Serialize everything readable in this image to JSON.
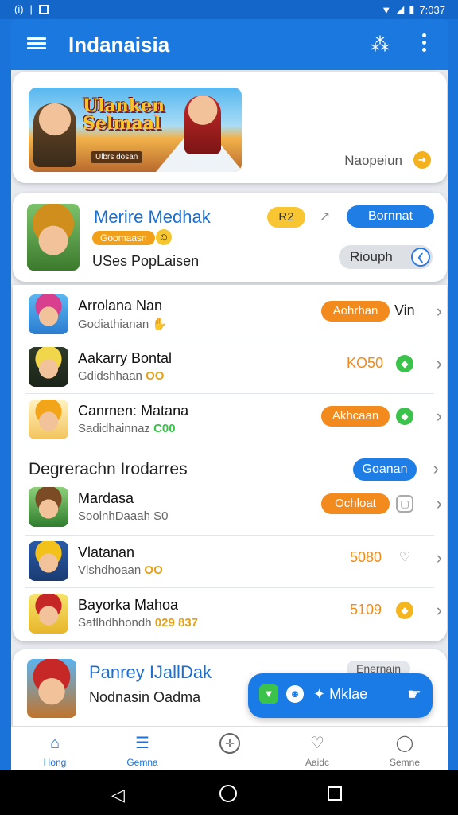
{
  "status_bar": {
    "left_text": "(i)",
    "time": "7:037"
  },
  "app_bar": {
    "title": "Indanaisia"
  },
  "banner": {
    "art_title": "Ulanken Selmaal",
    "art_subtitle": "Ulbrs dosan",
    "nav_label": "Naopeiun"
  },
  "featured": {
    "title": "Merire Medhak",
    "pill": "Goomaasn",
    "subtitle": "USes PopLaisen",
    "badge": "R2",
    "primary_button": "Bornnat",
    "secondary_button": "Riouph"
  },
  "list1": [
    {
      "name": "Arrolana Nan",
      "sub": "Godiathianan",
      "sub_accent": "",
      "pill": "Aohrhan",
      "value": "",
      "tail": "Vin",
      "icon": "hand-icon"
    },
    {
      "name": "Aakarry Bontal",
      "sub": "Gdidshhaan",
      "sub_accent": "OO",
      "pill": "",
      "value": "KO50",
      "tail": "",
      "icon": "diamond-icon"
    },
    {
      "name": "Canrnen: Matana",
      "sub": "Sadidhainnaz",
      "sub_accent": "C00",
      "pill": "Akhcaan",
      "value": "",
      "tail": "",
      "icon": "diamond-icon"
    }
  ],
  "section": {
    "title": "Degrerachn Irodarres",
    "button": "Goanan"
  },
  "list2": [
    {
      "name": "Mardasa",
      "sub": "SoolnhDaaah S0",
      "sub_accent": "",
      "pill": "Ochloat",
      "value": "",
      "icon": "square-icon"
    },
    {
      "name": "Vlatanan",
      "sub": "Vlshdhoaan",
      "sub_accent": "OO",
      "pill": "",
      "value": "5080",
      "icon": "heart-icon"
    },
    {
      "name": "Bayorka Mahoa",
      "sub": "Saflhdhhondh",
      "sub_accent": "029 837",
      "pill": "",
      "value": "5109",
      "icon": "gem-icon"
    }
  ],
  "bottom_card": {
    "title": "Panrey IJallDak",
    "subtitle": "Nodnasin Oadma",
    "tag": "Enernain"
  },
  "fab": {
    "label": "Mklae"
  },
  "bottom_nav": [
    {
      "label": "Hong",
      "icon": "home-icon"
    },
    {
      "label": "Gemna",
      "icon": "list-icon"
    },
    {
      "label": "",
      "icon": "compass-icon"
    },
    {
      "label": "Aaidc",
      "icon": "heart-icon"
    },
    {
      "label": "Semne",
      "icon": "person-icon"
    }
  ],
  "colors": {
    "primary": "#1a73d9",
    "accent_orange": "#f28a1d",
    "accent_yellow": "#f8c533",
    "green": "#3bc24a"
  }
}
